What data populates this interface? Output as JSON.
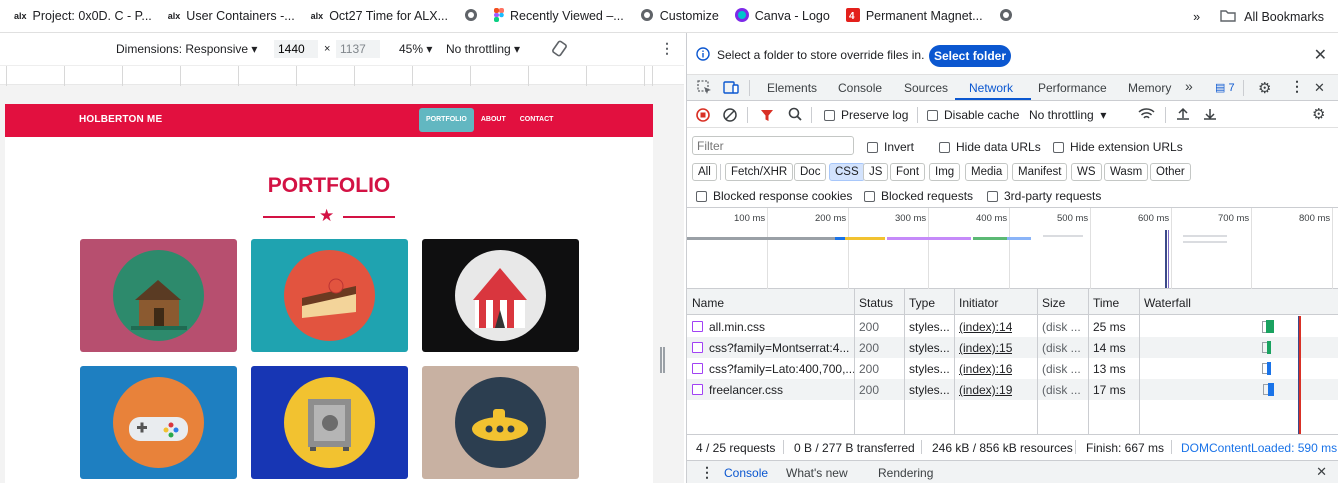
{
  "bookmarks": {
    "items": [
      {
        "label": "Project: 0x0D. C - P...",
        "icon": "alx-icon"
      },
      {
        "label": "User Containers -...",
        "icon": "alx-icon"
      },
      {
        "label": "Oct27 Time for ALX...",
        "icon": "alx-icon"
      },
      {
        "label": "",
        "icon": "globe-icon"
      },
      {
        "label": "Recently Viewed –...",
        "icon": "figma-icon"
      },
      {
        "label": "Customize",
        "icon": "globe-icon"
      },
      {
        "label": "Canva - Logo",
        "icon": "canva-icon"
      },
      {
        "label": "Permanent Magnet...",
        "icon": "magnet-icon"
      },
      {
        "label": "",
        "icon": "globe-icon"
      }
    ],
    "more": "»",
    "all_bookmarks": "All Bookmarks"
  },
  "device_toolbar": {
    "dimensions": "Dimensions: Responsive",
    "width": "1440",
    "x": "×",
    "height": "1137",
    "zoom": "45%",
    "throttling": "No throttling"
  },
  "site": {
    "brand": "HOLBERTON ME",
    "nav": [
      "PORTFOLIO",
      "ABOUT",
      "CONTACT"
    ],
    "section_title": "PORTFOLIO",
    "cards": [
      {
        "name": "cabin",
        "bg": "#b74f6f"
      },
      {
        "name": "cake",
        "bg": "#1fa3b0"
      },
      {
        "name": "circus",
        "bg": "#0f0f10"
      },
      {
        "name": "game",
        "bg": "#1e7fc1"
      },
      {
        "name": "safe",
        "bg": "#1736b4"
      },
      {
        "name": "submarine",
        "bg": "#c8b1a2"
      }
    ]
  },
  "devtools": {
    "info_text": "Select a folder to store override files in.",
    "select_folder": "Select folder",
    "tabs": [
      "Elements",
      "Console",
      "Sources",
      "Network",
      "Performance",
      "Memory"
    ],
    "active_tab": "Network",
    "issues_count": "7",
    "preserve_log": "Preserve log",
    "disable_cache": "Disable cache",
    "throttling": "No throttling",
    "filter_placeholder": "Filter",
    "invert": "Invert",
    "hide_data_urls": "Hide data URLs",
    "hide_extension_urls": "Hide extension URLs",
    "type_filters": [
      "All",
      "Fetch/XHR",
      "Doc",
      "CSS",
      "JS",
      "Font",
      "Img",
      "Media",
      "Manifest",
      "WS",
      "Wasm",
      "Other"
    ],
    "selected_filter": "CSS",
    "blocked_response_cookies": "Blocked response cookies",
    "blocked_requests": "Blocked requests",
    "third_party": "3rd-party requests",
    "timeline_ticks": [
      "100 ms",
      "200 ms",
      "300 ms",
      "400 ms",
      "500 ms",
      "600 ms",
      "700 ms",
      "800 ms"
    ],
    "columns": [
      "Name",
      "Status",
      "Type",
      "Initiator",
      "Size",
      "Time",
      "Waterfall"
    ],
    "rows": [
      {
        "name": "all.min.css",
        "status": "200",
        "type": "styles...",
        "initiator": "(index):14",
        "size": "(disk ...",
        "time": "25 ms"
      },
      {
        "name": "css?family=Montserrat:4...",
        "status": "200",
        "type": "styles...",
        "initiator": "(index):15",
        "size": "(disk ...",
        "time": "14 ms"
      },
      {
        "name": "css?family=Lato:400,700,...",
        "status": "200",
        "type": "styles...",
        "initiator": "(index):16",
        "size": "(disk ...",
        "time": "13 ms"
      },
      {
        "name": "freelancer.css",
        "status": "200",
        "type": "styles...",
        "initiator": "(index):19",
        "size": "(disk ...",
        "time": "17 ms"
      }
    ],
    "summary": {
      "requests": "4 / 25 requests",
      "transferred": "0 B / 277 B transferred",
      "resources": "246 kB / 856 kB resources",
      "finish": "Finish: 667 ms",
      "dcl": "DOMContentLoaded: 590 ms"
    },
    "drawer_tabs": [
      "Console",
      "What's new",
      "Rendering"
    ],
    "accent": "#0b57d0"
  }
}
